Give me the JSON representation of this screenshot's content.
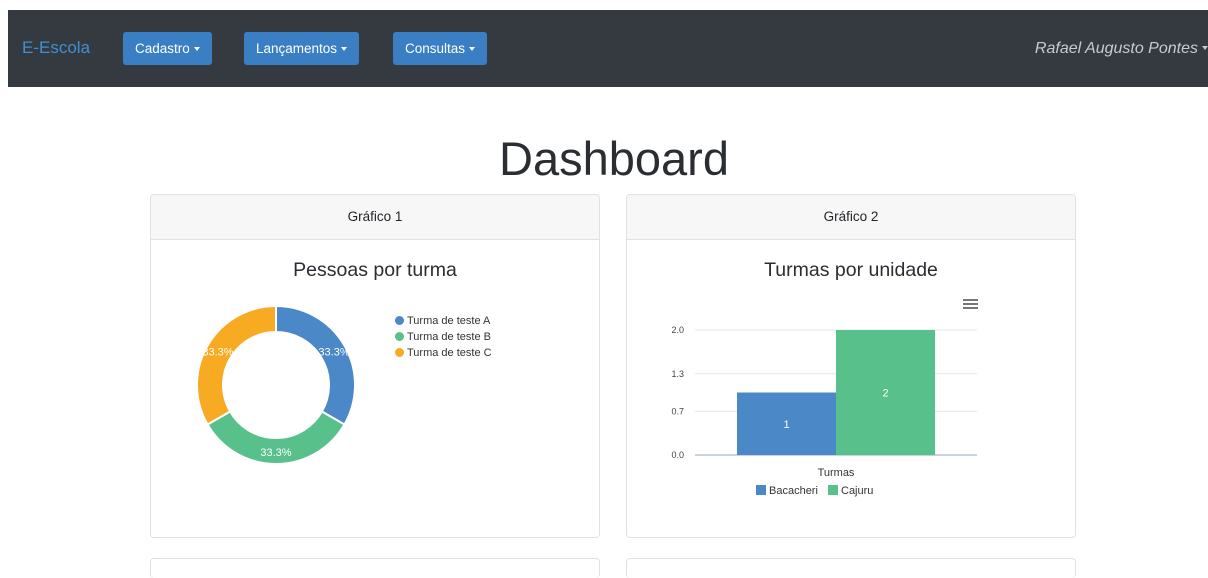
{
  "navbar": {
    "brand": "E-Escola",
    "menus": [
      {
        "label": "Cadastro"
      },
      {
        "label": "Lançamentos"
      },
      {
        "label": "Consultas"
      }
    ],
    "user": "Rafael Augusto Pontes"
  },
  "page": {
    "title": "Dashboard"
  },
  "cards": [
    {
      "header": "Gráfico 1",
      "title": "Pessoas por turma"
    },
    {
      "header": "Gráfico 2",
      "title": "Turmas por unidade"
    }
  ],
  "colors": {
    "blue": "#4a88c7",
    "green": "#58c08a",
    "orange": "#f7ab22"
  },
  "chart_data": [
    {
      "type": "pie",
      "title": "Pessoas por turma",
      "donut": true,
      "categories": [
        "Turma de teste A",
        "Turma de teste B",
        "Turma de teste C"
      ],
      "values": [
        33.3,
        33.3,
        33.3
      ],
      "data_labels": [
        "33.3%",
        "33.3%",
        "33.3%"
      ],
      "legend": "right"
    },
    {
      "type": "bar",
      "title": "Turmas por unidade",
      "categories": [
        "Turmas"
      ],
      "xlabel": "",
      "series": [
        {
          "name": "Bacacheri",
          "values": [
            1
          ]
        },
        {
          "name": "Cajuru",
          "values": [
            2
          ]
        }
      ],
      "yticks": [
        "0.0",
        "0.7",
        "1.3",
        "2.0"
      ],
      "ylim": [
        0,
        2
      ],
      "grid": true,
      "legend": "bottom"
    }
  ]
}
